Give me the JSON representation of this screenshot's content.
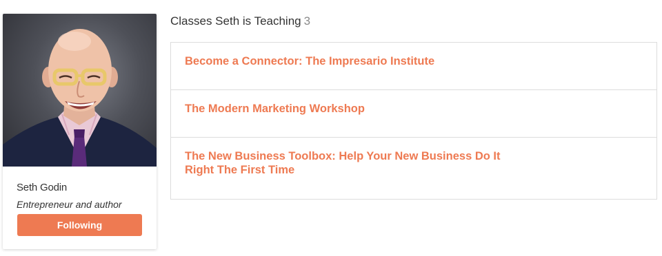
{
  "profile": {
    "name": "Seth Godin",
    "role": "Entrepreneur and author",
    "follow_label": "Following",
    "accent_color": "#ee7a52"
  },
  "classes": {
    "title": "Classes Seth is Teaching",
    "count": "3",
    "items": [
      {
        "label": "Become a Connector: The Impresario Institute"
      },
      {
        "label": "The Modern Marketing Workshop"
      },
      {
        "label": "The New Business Toolbox: Help Your New Business Do It Right The First Time"
      }
    ]
  }
}
